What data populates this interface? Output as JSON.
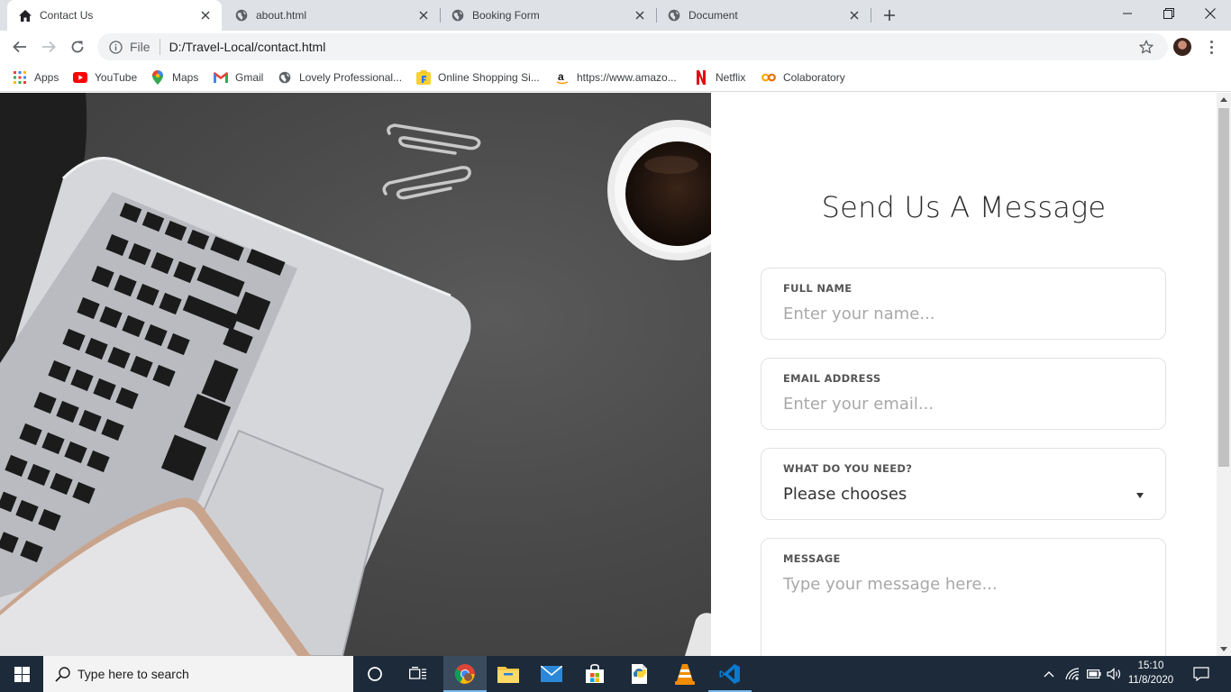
{
  "browser": {
    "tabs": [
      {
        "title": "Contact Us",
        "icon": "home-icon",
        "active": true
      },
      {
        "title": "about.html",
        "icon": "globe-icon",
        "active": false
      },
      {
        "title": "Booking Form",
        "icon": "globe-icon",
        "active": false
      },
      {
        "title": "Document",
        "icon": "globe-icon",
        "active": false
      }
    ],
    "address": {
      "scheme": "File",
      "url": "D:/Travel-Local/contact.html"
    },
    "bookmarks": [
      {
        "label": "Apps",
        "icon": "apps-grid-icon"
      },
      {
        "label": "YouTube",
        "icon": "youtube-icon"
      },
      {
        "label": "Maps",
        "icon": "maps-icon"
      },
      {
        "label": "Gmail",
        "icon": "gmail-icon"
      },
      {
        "label": "Lovely Professional...",
        "icon": "globe-icon"
      },
      {
        "label": "Online Shopping Si...",
        "icon": "flipkart-icon"
      },
      {
        "label": "https://www.amazo...",
        "icon": "amazon-icon"
      },
      {
        "label": "Netflix",
        "icon": "netflix-icon"
      },
      {
        "label": "Colaboratory",
        "icon": "colab-icon"
      }
    ]
  },
  "form": {
    "title": "Send Us A Message",
    "name_label": "FULL NAME",
    "name_placeholder": "Enter your name...",
    "email_label": "EMAIL ADDRESS",
    "email_placeholder": "Enter your email...",
    "need_label": "WHAT DO YOU NEED?",
    "need_value": "Please chooses",
    "message_label": "MESSAGE",
    "message_placeholder": "Type your message here..."
  },
  "taskbar": {
    "search_placeholder": "Type here to search",
    "time": "15:10",
    "date": "11/8/2020"
  },
  "colors": {
    "taskbar": "#1c2a3a",
    "tabstrip": "#dee1e6",
    "accent_underline": "#76b9ed"
  }
}
